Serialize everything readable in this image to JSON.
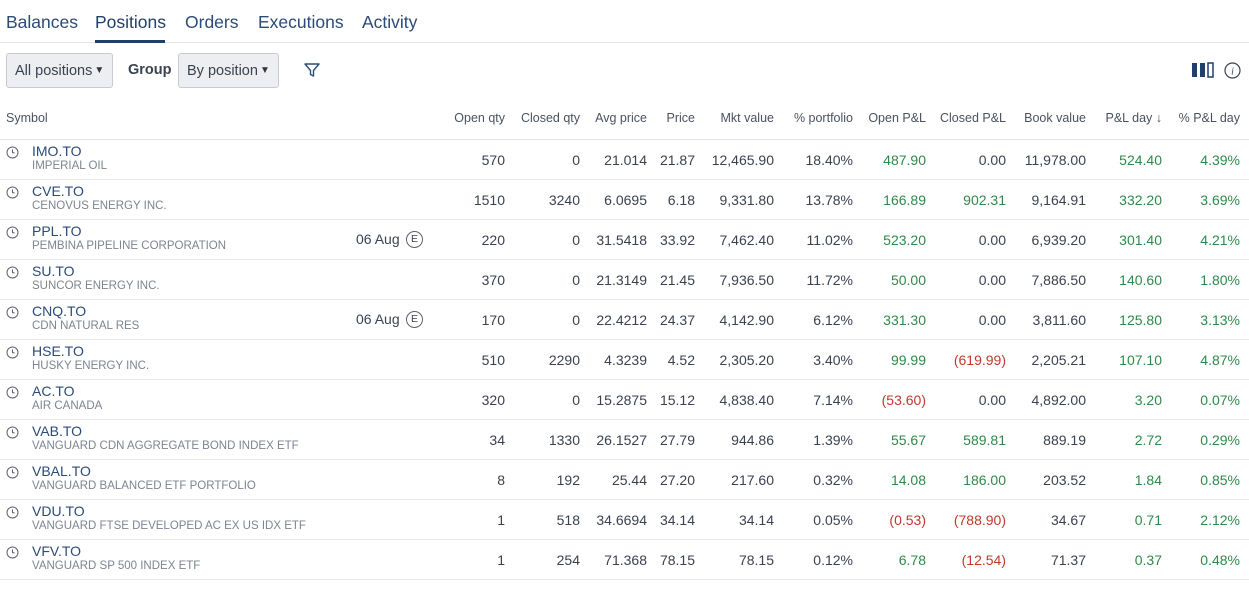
{
  "tabs": [
    {
      "label": "Balances"
    },
    {
      "label": "Positions"
    },
    {
      "label": "Orders"
    },
    {
      "label": "Executions"
    },
    {
      "label": "Activity"
    }
  ],
  "active_tab": "Positions",
  "toolbar": {
    "filter_select": "All positions",
    "group_label": "Group",
    "group_select": "By position"
  },
  "colors": {
    "link": "#2b4b7a",
    "positive": "#2f8a4a",
    "negative": "#c0392b",
    "accent": "#1f3f6e"
  },
  "columns": {
    "symbol": "Symbol",
    "open_qty": "Open qty",
    "closed_qty": "Closed qty",
    "avg_price": "Avg price",
    "price": "Price",
    "mkt_value": "Mkt value",
    "pct_portfolio": "% portfolio",
    "open_pl": "Open P&L",
    "closed_pl": "Closed P&L",
    "book_value": "Book value",
    "pl_day": "P&L day ↓",
    "pct_pl_day": "% P&L day"
  },
  "rows": [
    {
      "symbol": "IMO.TO",
      "desc": "IMPERIAL OIL",
      "event_date": "",
      "event_badge": "",
      "open_qty": "570",
      "closed_qty": "0",
      "avg_price": "21.014",
      "price": "21.87",
      "mkt_value": "12,465.90",
      "pct_portfolio": "18.40%",
      "open_pl": "487.90",
      "open_pl_sign": "pos",
      "closed_pl": "0.00",
      "closed_pl_sign": "neutral",
      "book_value": "11,978.00",
      "pl_day": "524.40",
      "pl_day_sign": "pos",
      "pct_pl_day": "4.39%",
      "pct_pl_day_sign": "pos"
    },
    {
      "symbol": "CVE.TO",
      "desc": "CENOVUS ENERGY INC.",
      "event_date": "",
      "event_badge": "",
      "open_qty": "1510",
      "closed_qty": "3240",
      "avg_price": "6.0695",
      "price": "6.18",
      "mkt_value": "9,331.80",
      "pct_portfolio": "13.78%",
      "open_pl": "166.89",
      "open_pl_sign": "pos",
      "closed_pl": "902.31",
      "closed_pl_sign": "pos",
      "book_value": "9,164.91",
      "pl_day": "332.20",
      "pl_day_sign": "pos",
      "pct_pl_day": "3.69%",
      "pct_pl_day_sign": "pos"
    },
    {
      "symbol": "PPL.TO",
      "desc": "PEMBINA PIPELINE CORPORATION",
      "event_date": "06 Aug",
      "event_badge": "E",
      "open_qty": "220",
      "closed_qty": "0",
      "avg_price": "31.5418",
      "price": "33.92",
      "mkt_value": "7,462.40",
      "pct_portfolio": "11.02%",
      "open_pl": "523.20",
      "open_pl_sign": "pos",
      "closed_pl": "0.00",
      "closed_pl_sign": "neutral",
      "book_value": "6,939.20",
      "pl_day": "301.40",
      "pl_day_sign": "pos",
      "pct_pl_day": "4.21%",
      "pct_pl_day_sign": "pos"
    },
    {
      "symbol": "SU.TO",
      "desc": "SUNCOR ENERGY INC.",
      "event_date": "",
      "event_badge": "",
      "open_qty": "370",
      "closed_qty": "0",
      "avg_price": "21.3149",
      "price": "21.45",
      "mkt_value": "7,936.50",
      "pct_portfolio": "11.72%",
      "open_pl": "50.00",
      "open_pl_sign": "pos",
      "closed_pl": "0.00",
      "closed_pl_sign": "neutral",
      "book_value": "7,886.50",
      "pl_day": "140.60",
      "pl_day_sign": "pos",
      "pct_pl_day": "1.80%",
      "pct_pl_day_sign": "pos"
    },
    {
      "symbol": "CNQ.TO",
      "desc": "CDN NATURAL RES",
      "event_date": "06 Aug",
      "event_badge": "E",
      "open_qty": "170",
      "closed_qty": "0",
      "avg_price": "22.4212",
      "price": "24.37",
      "mkt_value": "4,142.90",
      "pct_portfolio": "6.12%",
      "open_pl": "331.30",
      "open_pl_sign": "pos",
      "closed_pl": "0.00",
      "closed_pl_sign": "neutral",
      "book_value": "3,811.60",
      "pl_day": "125.80",
      "pl_day_sign": "pos",
      "pct_pl_day": "3.13%",
      "pct_pl_day_sign": "pos"
    },
    {
      "symbol": "HSE.TO",
      "desc": "HUSKY ENERGY INC.",
      "event_date": "",
      "event_badge": "",
      "open_qty": "510",
      "closed_qty": "2290",
      "avg_price": "4.3239",
      "price": "4.52",
      "mkt_value": "2,305.20",
      "pct_portfolio": "3.40%",
      "open_pl": "99.99",
      "open_pl_sign": "pos",
      "closed_pl": "(619.99)",
      "closed_pl_sign": "neg",
      "book_value": "2,205.21",
      "pl_day": "107.10",
      "pl_day_sign": "pos",
      "pct_pl_day": "4.87%",
      "pct_pl_day_sign": "pos"
    },
    {
      "symbol": "AC.TO",
      "desc": "AIR CANADA",
      "event_date": "",
      "event_badge": "",
      "open_qty": "320",
      "closed_qty": "0",
      "avg_price": "15.2875",
      "price": "15.12",
      "mkt_value": "4,838.40",
      "pct_portfolio": "7.14%",
      "open_pl": "(53.60)",
      "open_pl_sign": "neg",
      "closed_pl": "0.00",
      "closed_pl_sign": "neutral",
      "book_value": "4,892.00",
      "pl_day": "3.20",
      "pl_day_sign": "pos",
      "pct_pl_day": "0.07%",
      "pct_pl_day_sign": "pos"
    },
    {
      "symbol": "VAB.TO",
      "desc": "VANGUARD CDN AGGREGATE BOND INDEX ETF",
      "event_date": "",
      "event_badge": "",
      "open_qty": "34",
      "closed_qty": "1330",
      "avg_price": "26.1527",
      "price": "27.79",
      "mkt_value": "944.86",
      "pct_portfolio": "1.39%",
      "open_pl": "55.67",
      "open_pl_sign": "pos",
      "closed_pl": "589.81",
      "closed_pl_sign": "pos",
      "book_value": "889.19",
      "pl_day": "2.72",
      "pl_day_sign": "pos",
      "pct_pl_day": "0.29%",
      "pct_pl_day_sign": "pos"
    },
    {
      "symbol": "VBAL.TO",
      "desc": "VANGUARD BALANCED ETF PORTFOLIO",
      "event_date": "",
      "event_badge": "",
      "open_qty": "8",
      "closed_qty": "192",
      "avg_price": "25.44",
      "price": "27.20",
      "mkt_value": "217.60",
      "pct_portfolio": "0.32%",
      "open_pl": "14.08",
      "open_pl_sign": "pos",
      "closed_pl": "186.00",
      "closed_pl_sign": "pos",
      "book_value": "203.52",
      "pl_day": "1.84",
      "pl_day_sign": "pos",
      "pct_pl_day": "0.85%",
      "pct_pl_day_sign": "pos"
    },
    {
      "symbol": "VDU.TO",
      "desc": "VANGUARD FTSE DEVELOPED AC EX US IDX ETF",
      "event_date": "",
      "event_badge": "",
      "open_qty": "1",
      "closed_qty": "518",
      "avg_price": "34.6694",
      "price": "34.14",
      "mkt_value": "34.14",
      "pct_portfolio": "0.05%",
      "open_pl": "(0.53)",
      "open_pl_sign": "neg",
      "closed_pl": "(788.90)",
      "closed_pl_sign": "neg",
      "book_value": "34.67",
      "pl_day": "0.71",
      "pl_day_sign": "pos",
      "pct_pl_day": "2.12%",
      "pct_pl_day_sign": "pos"
    },
    {
      "symbol": "VFV.TO",
      "desc": "VANGUARD SP 500 INDEX ETF",
      "event_date": "",
      "event_badge": "",
      "open_qty": "1",
      "closed_qty": "254",
      "avg_price": "71.368",
      "price": "78.15",
      "mkt_value": "78.15",
      "pct_portfolio": "0.12%",
      "open_pl": "6.78",
      "open_pl_sign": "pos",
      "closed_pl": "(12.54)",
      "closed_pl_sign": "neg",
      "book_value": "71.37",
      "pl_day": "0.37",
      "pl_day_sign": "pos",
      "pct_pl_day": "0.48%",
      "pct_pl_day_sign": "pos"
    }
  ]
}
